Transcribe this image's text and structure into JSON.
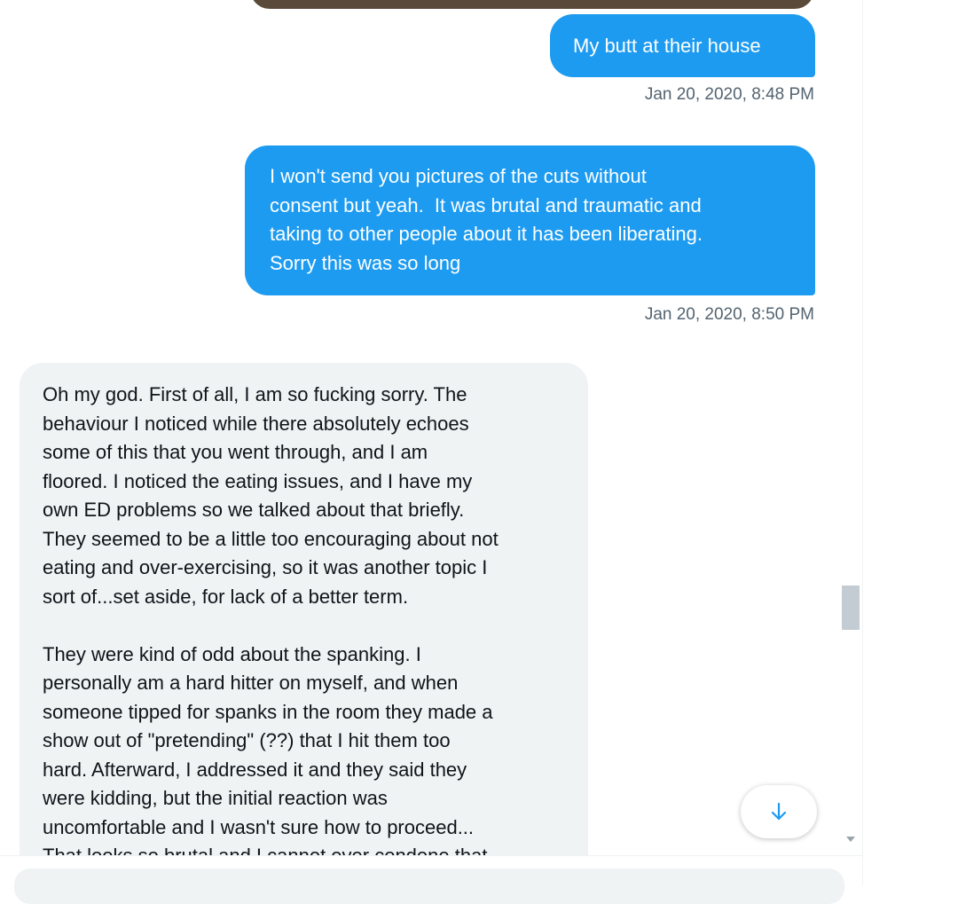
{
  "messages": [
    {
      "direction": "sent",
      "text": "My butt at their house",
      "timestamp": "Jan 20, 2020, 8:48 PM"
    },
    {
      "direction": "sent",
      "text": "I won't send you pictures of the cuts without\nconsent but yeah.  It was brutal and traumatic and\ntaking to other people about it has been liberating.\nSorry this was so long",
      "timestamp": "Jan 20, 2020, 8:50 PM"
    },
    {
      "direction": "received",
      "text": "Oh my god. First of all, I am so fucking sorry. The\nbehaviour I noticed while there absolutely echoes\nsome of this that you went through, and I am\nfloored. I noticed the eating issues, and I have my\nown ED problems so we talked about that briefly.\nThey seemed to be a little too encouraging about not\neating and over-exercising, so it was another topic I\nsort of...set aside, for lack of a better term.\n\nThey were kind of odd about the spanking. I\npersonally am a hard hitter on myself, and when\nsomeone tipped for spanks in the room they made a\nshow out of \"pretending\" (??) that I hit them too\nhard. Afterward, I addressed it and they said they\nwere kidding, but the initial reaction was\nuncomfortable and I wasn't sure how to proceed...\nThat looks so brutal and I cannot ever condone that"
    }
  ],
  "scroll_button": {
    "icon": "arrow-down-icon",
    "color": "#1d9bf0"
  },
  "colors": {
    "sent_bubble": "#1d9bf0",
    "received_bubble": "#eff3f4",
    "timestamp": "#536471"
  }
}
